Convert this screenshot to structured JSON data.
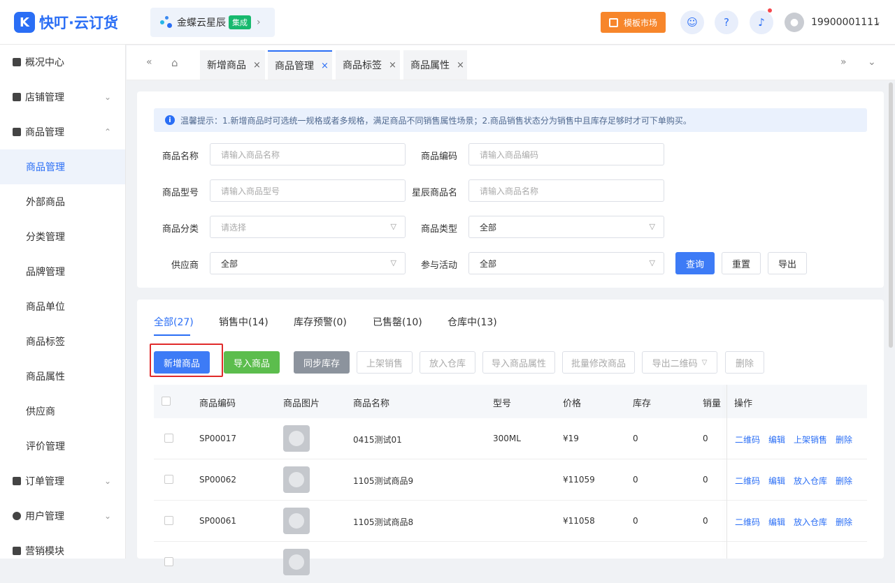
{
  "header": {
    "logo_mark": "K",
    "logo_text": "快叮·云订货",
    "kingdee": {
      "name": "金蝶云星辰",
      "badge": "集成",
      "arrow": "›"
    },
    "market": "模板市场",
    "user": "19900001111",
    "user_arrow": "⌄"
  },
  "sidebar": {
    "groups": [
      {
        "label": "概况中心"
      },
      {
        "label": "店铺管理",
        "chev": "⌄"
      },
      {
        "label": "商品管理",
        "chev": "⌃"
      },
      {
        "label": "订单管理",
        "chev": "⌄"
      },
      {
        "label": "用户管理",
        "chev": "⌄"
      },
      {
        "label": "营销模块"
      }
    ],
    "sub": [
      "商品管理",
      "外部商品",
      "分类管理",
      "品牌管理",
      "商品单位",
      "商品标签",
      "商品属性",
      "供应商",
      "评价管理"
    ]
  },
  "tabs": [
    {
      "label": "新增商品",
      "close": "×"
    },
    {
      "label": "商品管理",
      "close": "×"
    },
    {
      "label": "商品标签",
      "close": "×"
    },
    {
      "label": "商品属性",
      "close": "×"
    }
  ],
  "tip": {
    "icon": "i",
    "text": "温馨提示：1.新增商品时可选统一规格或者多规格，满足商品不同销售属性场景；2.商品销售状态分为销售中且库存足够时才可下单购买。"
  },
  "filters": {
    "name_label": "商品名称",
    "name_ph": "请输入商品名称",
    "code_label": "商品编码",
    "code_ph": "请输入商品编码",
    "model_label": "商品型号",
    "model_ph": "请输入商品型号",
    "xc_label": "星辰商品名",
    "xc_ph": "请输入商品名称",
    "cat_label": "商品分类",
    "cat_ph": "请选择",
    "type_label": "商品类型",
    "type_val": "全部",
    "supplier_label": "供应商",
    "supplier_val": "全部",
    "activity_label": "参与活动",
    "activity_val": "全部",
    "query": "查询",
    "reset": "重置",
    "export": "导出"
  },
  "status_tabs": [
    "全部(27)",
    "销售中(14)",
    "库存预警(0)",
    "已售罄(10)",
    "仓库中(13)"
  ],
  "actions": {
    "add": "新增商品",
    "import": "导入商品",
    "sync": "同步库存",
    "onsale": "上架销售",
    "warehouse": "放入仓库",
    "import_attr": "导入商品属性",
    "batch_edit": "批量修改商品",
    "export_qr": "导出二维码",
    "delete": "删除"
  },
  "table": {
    "headers": [
      "商品编码",
      "商品图片",
      "商品名称",
      "型号",
      "价格",
      "库存",
      "销量",
      "操作"
    ],
    "rows": [
      {
        "code": "SP00017",
        "name": "0415测试01",
        "model": "300ML",
        "price": "¥19",
        "stock": "0",
        "sales": "0",
        "ops": [
          "二维码",
          "编辑",
          "上架销售",
          "删除"
        ]
      },
      {
        "code": "SP00062",
        "name": "1105测试商品9",
        "model": "",
        "price": "¥11059",
        "stock": "0",
        "sales": "0",
        "ops": [
          "二维码",
          "编辑",
          "放入仓库",
          "删除"
        ]
      },
      {
        "code": "SP00061",
        "name": "1105测试商品8",
        "model": "",
        "price": "¥11058",
        "stock": "0",
        "sales": "0",
        "ops": [
          "二维码",
          "编辑",
          "放入仓库",
          "删除"
        ]
      }
    ]
  }
}
